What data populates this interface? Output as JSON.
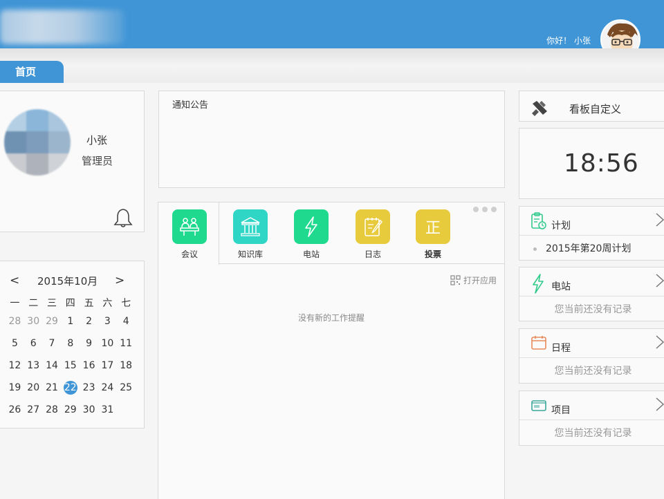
{
  "header": {
    "greeting": "你好！ 小张"
  },
  "tabs": [
    {
      "label": "首页"
    }
  ],
  "profile": {
    "name": "小张",
    "role": "管理员"
  },
  "calendar": {
    "title": "2015年10月",
    "prev": "<",
    "next": ">",
    "weekdays": [
      "一",
      "二",
      "三",
      "四",
      "五",
      "六",
      "七"
    ],
    "weeks": [
      [
        {
          "d": "28",
          "o": true
        },
        {
          "d": "30",
          "o": true
        },
        {
          "d": "29",
          "o": true
        },
        {
          "d": "1"
        },
        {
          "d": "2"
        },
        {
          "d": "3"
        },
        {
          "d": "4"
        }
      ],
      [
        {
          "d": "5"
        },
        {
          "d": "6"
        },
        {
          "d": "7"
        },
        {
          "d": "8"
        },
        {
          "d": "9"
        },
        {
          "d": "10"
        },
        {
          "d": "11"
        }
      ],
      [
        {
          "d": "12"
        },
        {
          "d": "13"
        },
        {
          "d": "14"
        },
        {
          "d": "15"
        },
        {
          "d": "16"
        },
        {
          "d": "17"
        },
        {
          "d": "18"
        }
      ],
      [
        {
          "d": "19"
        },
        {
          "d": "20"
        },
        {
          "d": "21"
        },
        {
          "d": "22",
          "t": true
        },
        {
          "d": "23"
        },
        {
          "d": "24"
        },
        {
          "d": "25"
        }
      ],
      [
        {
          "d": "26"
        },
        {
          "d": "27"
        },
        {
          "d": "28"
        },
        {
          "d": "29"
        },
        {
          "d": "30"
        },
        {
          "d": "31"
        },
        {
          "d": ""
        }
      ]
    ]
  },
  "notice": {
    "title": "通知公告"
  },
  "apps": {
    "items": [
      {
        "label": "会议",
        "icon": "meeting-icon",
        "color": "#1fd98f"
      },
      {
        "label": "知识库",
        "icon": "library-icon",
        "color": "#2fd6c6"
      },
      {
        "label": "电站",
        "icon": "lightning-icon",
        "color": "#1fd98f"
      },
      {
        "label": "日志",
        "icon": "notepad-icon",
        "color": "#e8cb3c"
      },
      {
        "label": "投票",
        "icon": "vote-icon",
        "color": "#e8cb3c"
      }
    ],
    "open_label": "打开应用",
    "empty_text": "没有新的工作提醒"
  },
  "board": {
    "label": "看板自定义"
  },
  "clock": {
    "time": "18:56"
  },
  "widgets": [
    {
      "title": "计划",
      "icon": "clipboard-icon",
      "body": "2015年第20周计划",
      "is_item": true
    },
    {
      "title": "电站",
      "icon": "lightning-icon",
      "body": "您当前还没有记录"
    },
    {
      "title": "日程",
      "icon": "calendar-icon",
      "body": "您当前还没有记录"
    },
    {
      "title": "项目",
      "icon": "folder-icon",
      "body": "您当前还没有记录"
    }
  ],
  "colors": {
    "accent": "#3f95d6",
    "green": "#1fd98f",
    "yellow": "#e8cb3c"
  }
}
